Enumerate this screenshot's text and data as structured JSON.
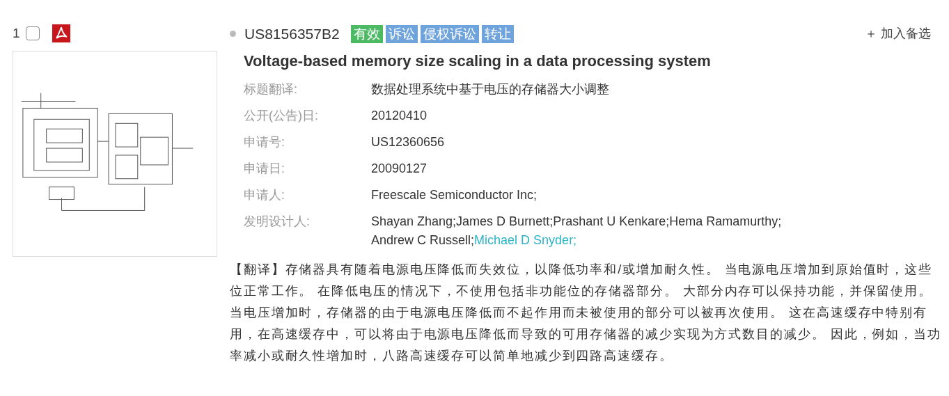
{
  "result": {
    "index": "1",
    "checked": false,
    "number": "US8156357B2",
    "tags": [
      {
        "label": "有效",
        "color": "#4cb963"
      },
      {
        "label": "诉讼",
        "color": "#6fa3dc"
      },
      {
        "label": "侵权诉讼",
        "color": "#6fa3dc"
      },
      {
        "label": "转让",
        "color": "#6fa3dc"
      }
    ],
    "add_button": {
      "icon": "＋",
      "label": "加入备选"
    },
    "title": "Voltage-based memory size scaling in a data processing system",
    "fields": [
      {
        "label": "标题翻译:",
        "value": "数据处理系统中基于电压的存储器大小调整"
      },
      {
        "label": "公开(公告)日:",
        "value": "20120410"
      },
      {
        "label": "申请号:",
        "value": "US12360656"
      },
      {
        "label": "申请日:",
        "value": "20090127"
      },
      {
        "label": "申请人:",
        "value": "Freescale Semiconductor Inc;"
      }
    ],
    "inventors": {
      "label": "发明设计人:",
      "items": [
        {
          "name": "Shayan Zhang;",
          "highlighted": false
        },
        {
          "name": "James D Burnett;",
          "highlighted": false
        },
        {
          "name": "Prashant U Kenkare;",
          "highlighted": false
        },
        {
          "name": "Hema Ramamurthy;",
          "highlighted": false
        },
        {
          "name": "Andrew C Russell;",
          "highlighted": false
        },
        {
          "name": "Michael D Snyder;",
          "highlighted": true
        }
      ]
    },
    "abstract": "【翻译】存储器具有随着电源电压降低而失效位，以降低功率和/或增加耐久性。 当电源电压增加到原始值时，这些位正常工作。 在降低电压的情况下，不使用包括非功能位的存储器部分。 大部分内存可以保持功能，并保留使用。当电压增加时，存储器的由于电源电压降低而不起作用而未被使用的部分可以被再次使用。 这在高速缓存中特别有用，在高速缓存中，可以将由于电源电压降低而导致的可用存储器的减少实现为方式数目的减少。 因此，例如，当功率减小或耐久性增加时，八路高速缓存可以简单地减少到四路高速缓存。"
  }
}
